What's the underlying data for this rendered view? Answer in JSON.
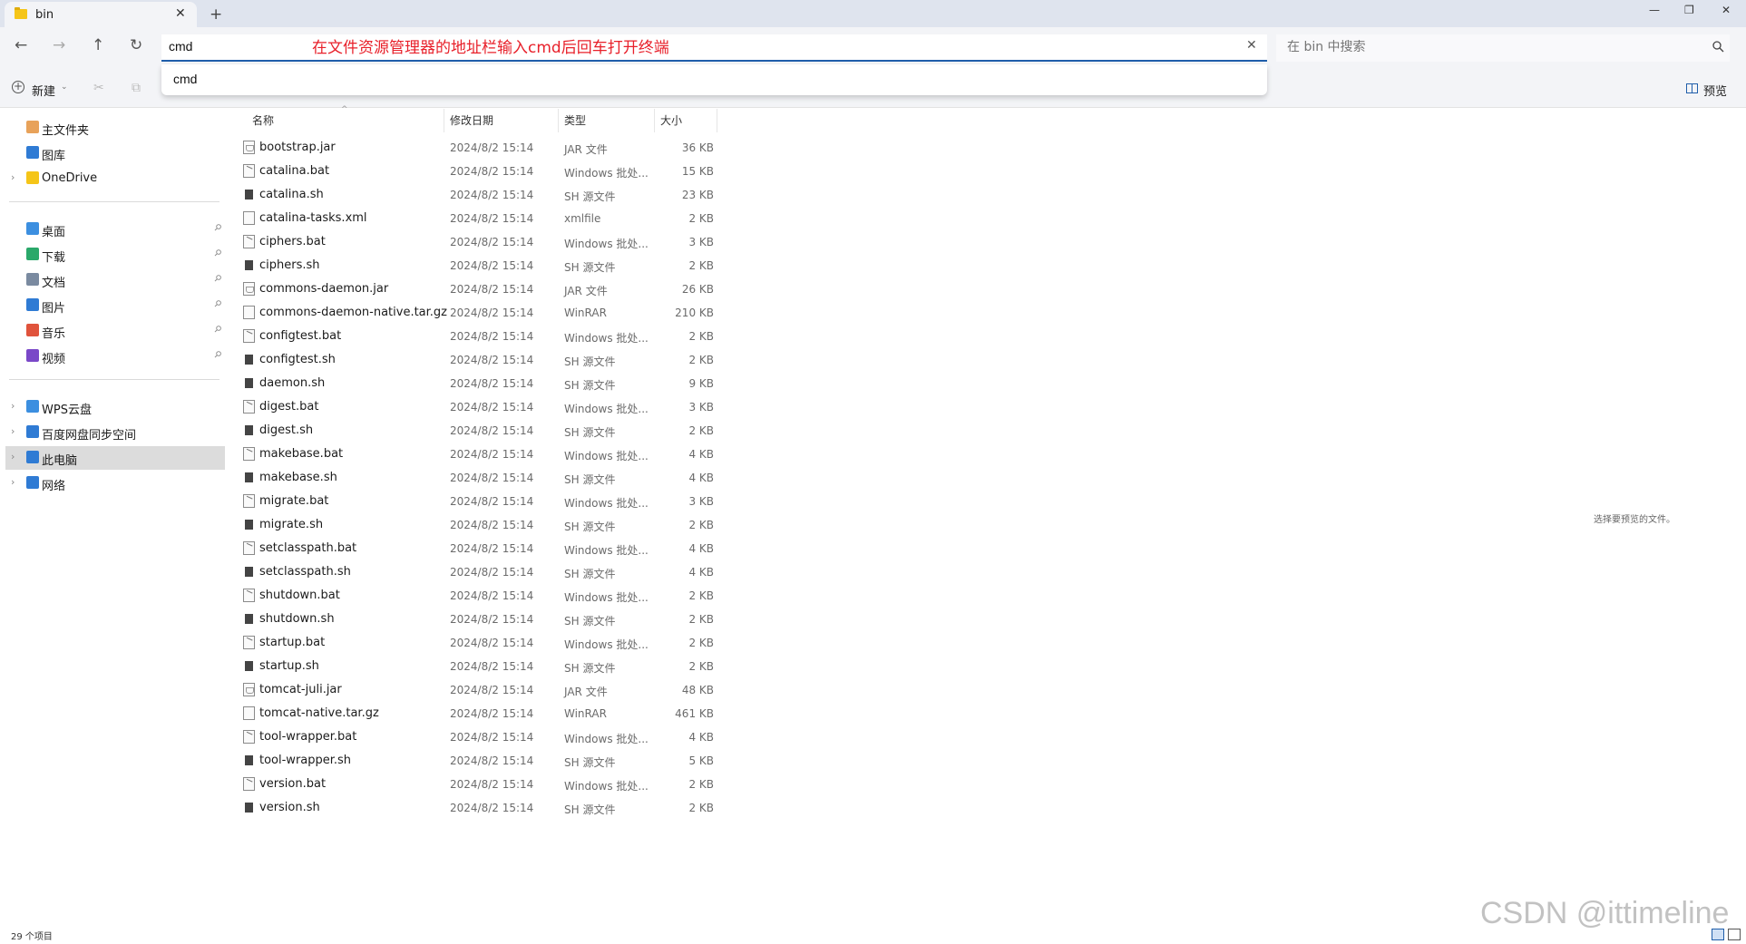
{
  "tab": {
    "title": "bin",
    "close": "✕",
    "new_tab": "+"
  },
  "window_controls": {
    "minimize": "—",
    "restore": "❐",
    "close": "✕"
  },
  "nav": {
    "back": "←",
    "forward": "→",
    "up": "↑",
    "refresh": "↻"
  },
  "address": {
    "value": "cmd",
    "clear": "✕",
    "suggestion": "cmd"
  },
  "annotation": "在文件资源管理器的地址栏输入cmd后回车打开终端",
  "search": {
    "placeholder": "在 bin 中搜索"
  },
  "toolbar": {
    "new_label": "新建",
    "new_caret": "⌄",
    "cut": "✂",
    "copy": "⧉",
    "preview_label": "预览"
  },
  "sidebar": {
    "items": [
      {
        "label": "主文件夹",
        "icon": "home-icon",
        "color": "#e8a25a"
      },
      {
        "label": "图库",
        "icon": "gallery-icon",
        "color": "#2f7bd4"
      },
      {
        "label": "OneDrive",
        "icon": "folder-icon",
        "color": "#f5c518",
        "chevron": "›"
      },
      {
        "label": "桌面",
        "icon": "desktop-icon",
        "color": "#3c8fe0",
        "pinned": true
      },
      {
        "label": "下载",
        "icon": "download-icon",
        "color": "#2aa86a",
        "pinned": true
      },
      {
        "label": "文档",
        "icon": "document-icon",
        "color": "#7a8aa0",
        "pinned": true
      },
      {
        "label": "图片",
        "icon": "pictures-icon",
        "color": "#2f7bd4",
        "pinned": true
      },
      {
        "label": "音乐",
        "icon": "music-icon",
        "color": "#e0533c",
        "pinned": true
      },
      {
        "label": "视频",
        "icon": "video-icon",
        "color": "#7a48c8",
        "pinned": true
      },
      {
        "label": "WPS云盘",
        "icon": "cloud-icon",
        "color": "#3c8fe0",
        "chevron": "›"
      },
      {
        "label": "百度网盘同步空间",
        "icon": "baidu-sync-icon",
        "color": "#2f7bd4",
        "chevron": "›"
      },
      {
        "label": "此电脑",
        "icon": "computer-icon",
        "color": "#2f7bd4",
        "chevron": "›",
        "selected": true
      },
      {
        "label": "网络",
        "icon": "network-icon",
        "color": "#2f7bd4",
        "chevron": "›"
      }
    ],
    "pin_glyph": "📌"
  },
  "columns": {
    "name": "名称",
    "date": "修改日期",
    "type": "类型",
    "size": "大小",
    "sort_glyph": "^"
  },
  "files": [
    {
      "name": "bootstrap.jar",
      "date": "2024/8/2 15:14",
      "type": "JAR 文件",
      "size": "36 KB",
      "kind": "jar"
    },
    {
      "name": "catalina.bat",
      "date": "2024/8/2 15:14",
      "type": "Windows 批处...",
      "size": "15 KB",
      "kind": "bat"
    },
    {
      "name": "catalina.sh",
      "date": "2024/8/2 15:14",
      "type": "SH 源文件",
      "size": "23 KB",
      "kind": "sh"
    },
    {
      "name": "catalina-tasks.xml",
      "date": "2024/8/2 15:14",
      "type": "xmlfile",
      "size": "2 KB",
      "kind": "file"
    },
    {
      "name": "ciphers.bat",
      "date": "2024/8/2 15:14",
      "type": "Windows 批处...",
      "size": "3 KB",
      "kind": "bat"
    },
    {
      "name": "ciphers.sh",
      "date": "2024/8/2 15:14",
      "type": "SH 源文件",
      "size": "2 KB",
      "kind": "sh"
    },
    {
      "name": "commons-daemon.jar",
      "date": "2024/8/2 15:14",
      "type": "JAR 文件",
      "size": "26 KB",
      "kind": "jar"
    },
    {
      "name": "commons-daemon-native.tar.gz",
      "date": "2024/8/2 15:14",
      "type": "WinRAR",
      "size": "210 KB",
      "kind": "file"
    },
    {
      "name": "configtest.bat",
      "date": "2024/8/2 15:14",
      "type": "Windows 批处...",
      "size": "2 KB",
      "kind": "bat"
    },
    {
      "name": "configtest.sh",
      "date": "2024/8/2 15:14",
      "type": "SH 源文件",
      "size": "2 KB",
      "kind": "sh"
    },
    {
      "name": "daemon.sh",
      "date": "2024/8/2 15:14",
      "type": "SH 源文件",
      "size": "9 KB",
      "kind": "sh"
    },
    {
      "name": "digest.bat",
      "date": "2024/8/2 15:14",
      "type": "Windows 批处...",
      "size": "3 KB",
      "kind": "bat"
    },
    {
      "name": "digest.sh",
      "date": "2024/8/2 15:14",
      "type": "SH 源文件",
      "size": "2 KB",
      "kind": "sh"
    },
    {
      "name": "makebase.bat",
      "date": "2024/8/2 15:14",
      "type": "Windows 批处...",
      "size": "4 KB",
      "kind": "bat"
    },
    {
      "name": "makebase.sh",
      "date": "2024/8/2 15:14",
      "type": "SH 源文件",
      "size": "4 KB",
      "kind": "sh"
    },
    {
      "name": "migrate.bat",
      "date": "2024/8/2 15:14",
      "type": "Windows 批处...",
      "size": "3 KB",
      "kind": "bat"
    },
    {
      "name": "migrate.sh",
      "date": "2024/8/2 15:14",
      "type": "SH 源文件",
      "size": "2 KB",
      "kind": "sh"
    },
    {
      "name": "setclasspath.bat",
      "date": "2024/8/2 15:14",
      "type": "Windows 批处...",
      "size": "4 KB",
      "kind": "bat"
    },
    {
      "name": "setclasspath.sh",
      "date": "2024/8/2 15:14",
      "type": "SH 源文件",
      "size": "4 KB",
      "kind": "sh"
    },
    {
      "name": "shutdown.bat",
      "date": "2024/8/2 15:14",
      "type": "Windows 批处...",
      "size": "2 KB",
      "kind": "bat"
    },
    {
      "name": "shutdown.sh",
      "date": "2024/8/2 15:14",
      "type": "SH 源文件",
      "size": "2 KB",
      "kind": "sh"
    },
    {
      "name": "startup.bat",
      "date": "2024/8/2 15:14",
      "type": "Windows 批处...",
      "size": "2 KB",
      "kind": "bat"
    },
    {
      "name": "startup.sh",
      "date": "2024/8/2 15:14",
      "type": "SH 源文件",
      "size": "2 KB",
      "kind": "sh"
    },
    {
      "name": "tomcat-juli.jar",
      "date": "2024/8/2 15:14",
      "type": "JAR 文件",
      "size": "48 KB",
      "kind": "jar"
    },
    {
      "name": "tomcat-native.tar.gz",
      "date": "2024/8/2 15:14",
      "type": "WinRAR",
      "size": "461 KB",
      "kind": "file"
    },
    {
      "name": "tool-wrapper.bat",
      "date": "2024/8/2 15:14",
      "type": "Windows 批处...",
      "size": "4 KB",
      "kind": "bat"
    },
    {
      "name": "tool-wrapper.sh",
      "date": "2024/8/2 15:14",
      "type": "SH 源文件",
      "size": "5 KB",
      "kind": "sh"
    },
    {
      "name": "version.bat",
      "date": "2024/8/2 15:14",
      "type": "Windows 批处...",
      "size": "2 KB",
      "kind": "bat"
    },
    {
      "name": "version.sh",
      "date": "2024/8/2 15:14",
      "type": "SH 源文件",
      "size": "2 KB",
      "kind": "sh"
    }
  ],
  "preview_empty": "选择要预览的文件。",
  "status": {
    "item_count": "29 个项目"
  },
  "watermark": "CSDN @ittimeline",
  "colors": {
    "accent": "#1f5eaa",
    "annotation": "#e8202a",
    "selected_row": "#dcdcdc"
  }
}
